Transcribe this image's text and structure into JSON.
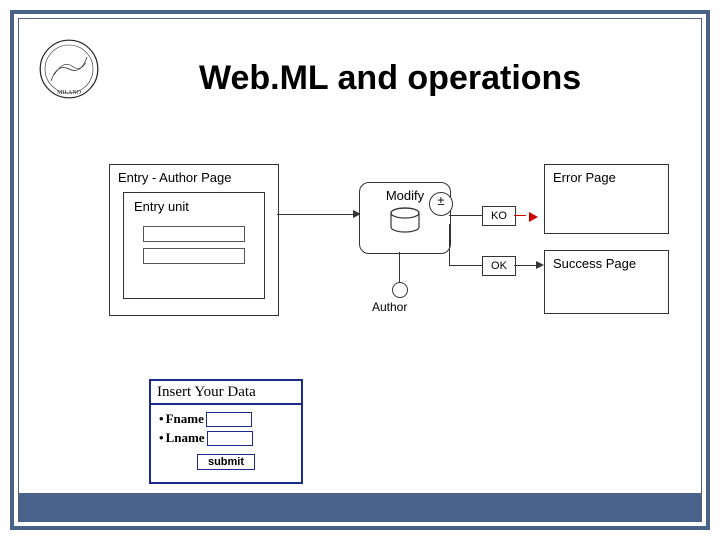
{
  "slide": {
    "title": "Web.ML and operations"
  },
  "diagram": {
    "entry_page_title": "Entry - Author Page",
    "entry_unit_title": "Entry unit",
    "modify_label": "Modify",
    "author_label": "Author",
    "ko_label": "KO",
    "ok_label": "OK",
    "error_page_label": "Error Page",
    "success_page_label": "Success Page",
    "plusminus": "±"
  },
  "form": {
    "header": "Insert Your Data",
    "fields": [
      {
        "label": "Fname"
      },
      {
        "label": "Lname"
      }
    ],
    "submit_label": "submit"
  }
}
